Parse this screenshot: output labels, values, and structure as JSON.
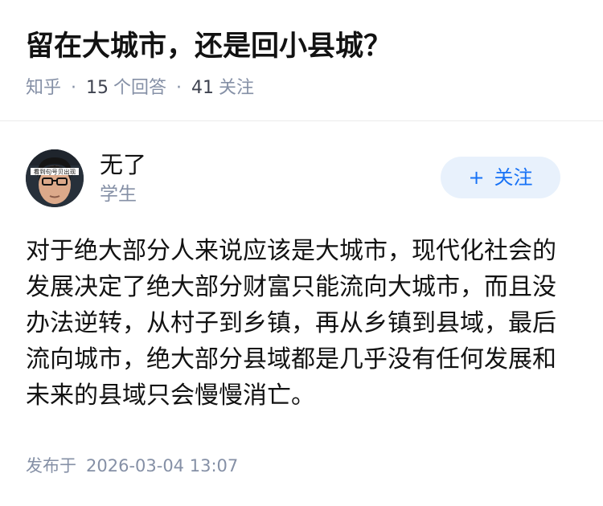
{
  "question": {
    "title": "留在大城市，还是回小县城？",
    "source": "知乎",
    "separator": "·",
    "answer_count": "15",
    "answer_label": "个回答",
    "follow_count": "41",
    "follow_label": "关注"
  },
  "author": {
    "name": "无了",
    "bio": "学生",
    "avatar_caption": "看到句号贝出现",
    "follow_button_icon": "+",
    "follow_button_label": "关注"
  },
  "answer": {
    "content": "对于绝大部分人来说应该是大城市，现代化社会的发展决定了绝大部分财富只能流向大城市，而且没办法逆转，从村子到乡镇，再从乡镇到县域，最后流向城市，绝大部分县域都是几乎没有任何发展和未来的县域只会慢慢消亡。",
    "published_label": "发布于",
    "published_time": "2026-03-04 13:07"
  },
  "colors": {
    "title_text": "#121212",
    "meta_text": "#8590a6",
    "follow_button_bg": "#e8f1fc",
    "follow_button_text": "#1772f6",
    "divider": "#ebebeb"
  }
}
